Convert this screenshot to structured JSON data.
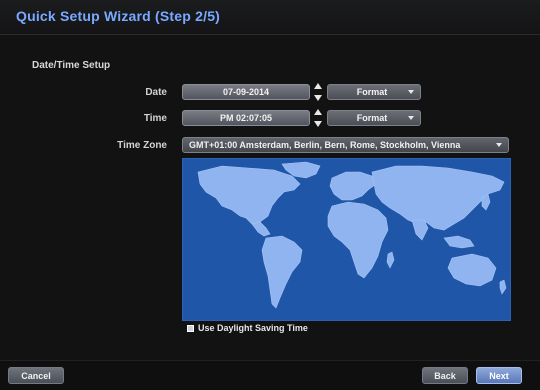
{
  "window": {
    "title": "Quick Setup Wizard (Step 2/5)"
  },
  "section": {
    "title": "Date/Time Setup"
  },
  "date": {
    "label": "Date",
    "value": "07-09-2014",
    "format_label": "Format"
  },
  "time": {
    "label": "Time",
    "value": "PM 02:07:05",
    "format_label": "Format"
  },
  "timezone": {
    "label": "Time Zone",
    "value": "GMT+01:00    Amsterdam, Berlin, Bern, Rome, Stockholm, Vienna"
  },
  "dst": {
    "label": "Use Daylight Saving Time",
    "checked": true
  },
  "buttons": {
    "cancel": "Cancel",
    "back": "Back",
    "next": "Next"
  },
  "icons": {
    "spinner": "up-down-arrows-icon",
    "dropdown": "chevron-down-icon",
    "map": "world-map"
  },
  "colors": {
    "title": "#79a9ff",
    "map_ocean": "#1f56a8",
    "map_land": "#8fb4f0",
    "next_button": "#5877b7"
  }
}
